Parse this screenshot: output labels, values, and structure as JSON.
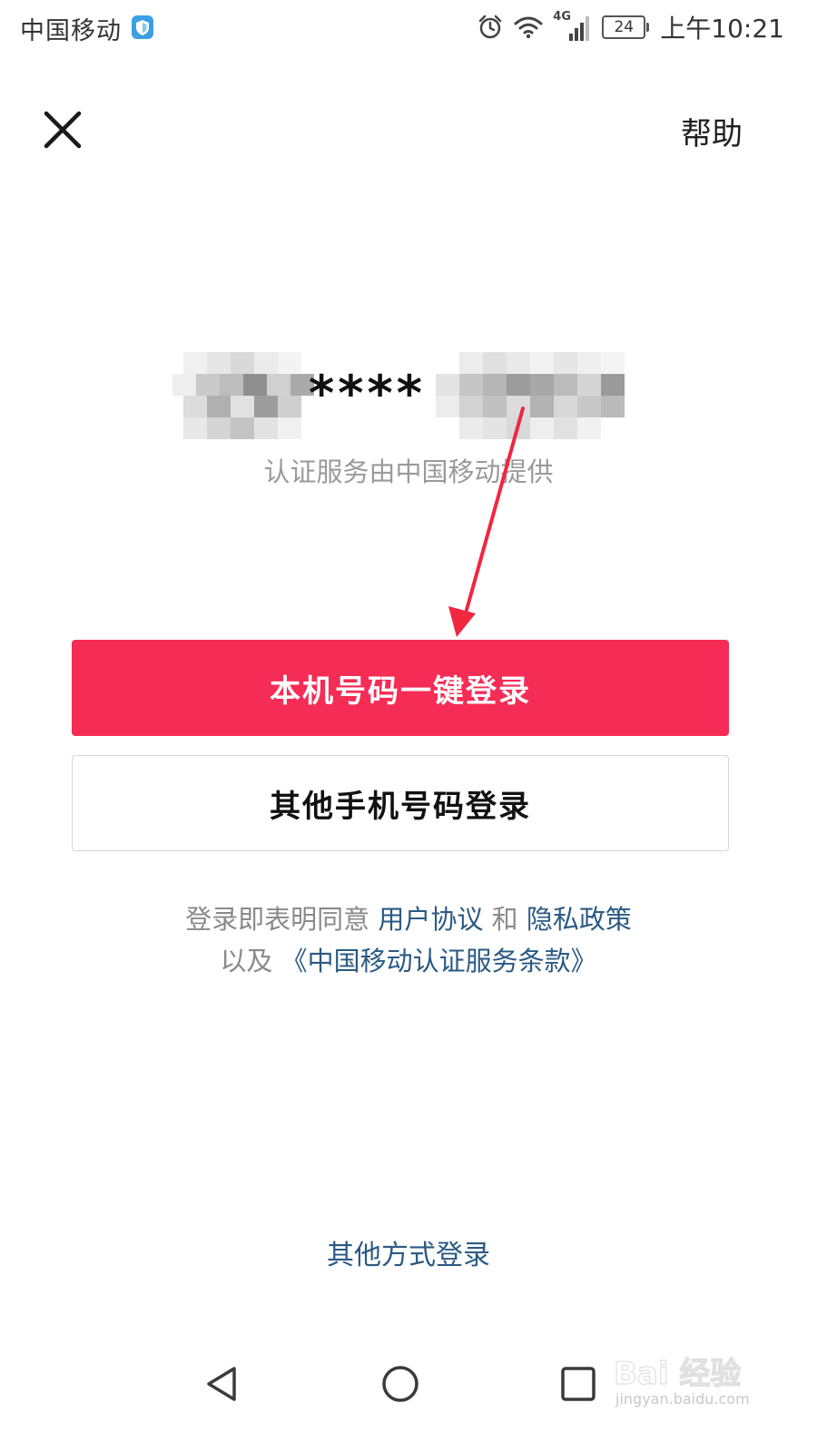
{
  "status_bar": {
    "carrier": "中国移动",
    "network": "4G",
    "battery": "24",
    "time": "上午10:21"
  },
  "header": {
    "help_label": "帮助"
  },
  "phone": {
    "masked_number": "****"
  },
  "auth_provider_text": "认证服务由中国移动提供",
  "buttons": {
    "one_click_login": "本机号码一键登录",
    "other_phone_login": "其他手机号码登录"
  },
  "agreement": {
    "prefix": "登录即表明同意",
    "user_agreement": "用户协议",
    "and": "和",
    "privacy_policy": "隐私政策",
    "also": "以及",
    "cmcc_terms": "《中国移动认证服务条款》"
  },
  "other_methods_label": "其他方式登录",
  "watermark": {
    "text": "Bai 经验",
    "url": "jingyan.baidu.com"
  },
  "colors": {
    "primary": "#f52c55",
    "link": "#2b5a83",
    "annotation_arrow": "#f0273f"
  }
}
